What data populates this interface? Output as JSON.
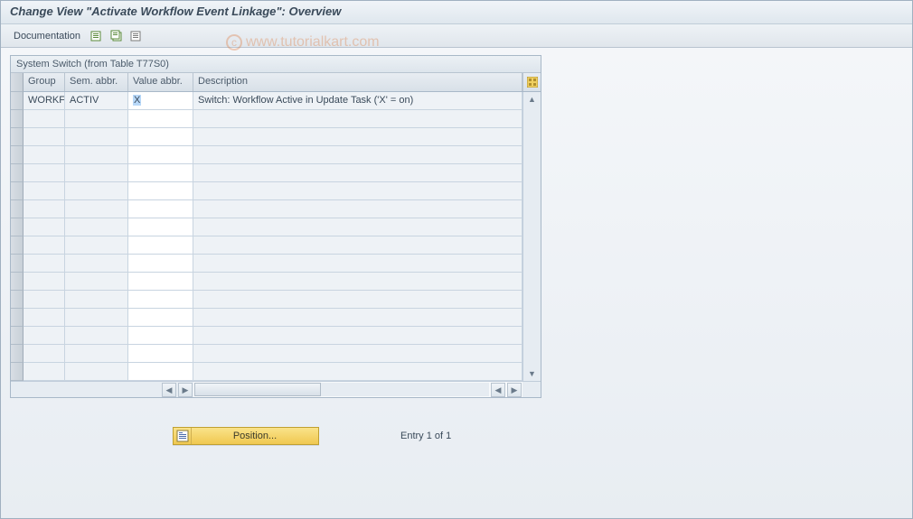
{
  "title": "Change View \"Activate Workflow Event Linkage\": Overview",
  "toolbar": {
    "documentation_label": "Documentation"
  },
  "panel": {
    "header": "System Switch (from Table T77S0)",
    "columns": {
      "group": "Group",
      "sem_abbr": "Sem. abbr.",
      "value_abbr": "Value abbr.",
      "description": "Description"
    },
    "rows": [
      {
        "group": "WORKF",
        "sem_abbr": "ACTIV",
        "value_abbr": "X",
        "description": "Switch: Workflow Active in Update Task ('X' = on)"
      }
    ],
    "empty_rows": 15
  },
  "footer": {
    "position_label": "Position...",
    "entry_text": "Entry 1 of 1"
  },
  "watermark": "www.tutorialkart.com"
}
